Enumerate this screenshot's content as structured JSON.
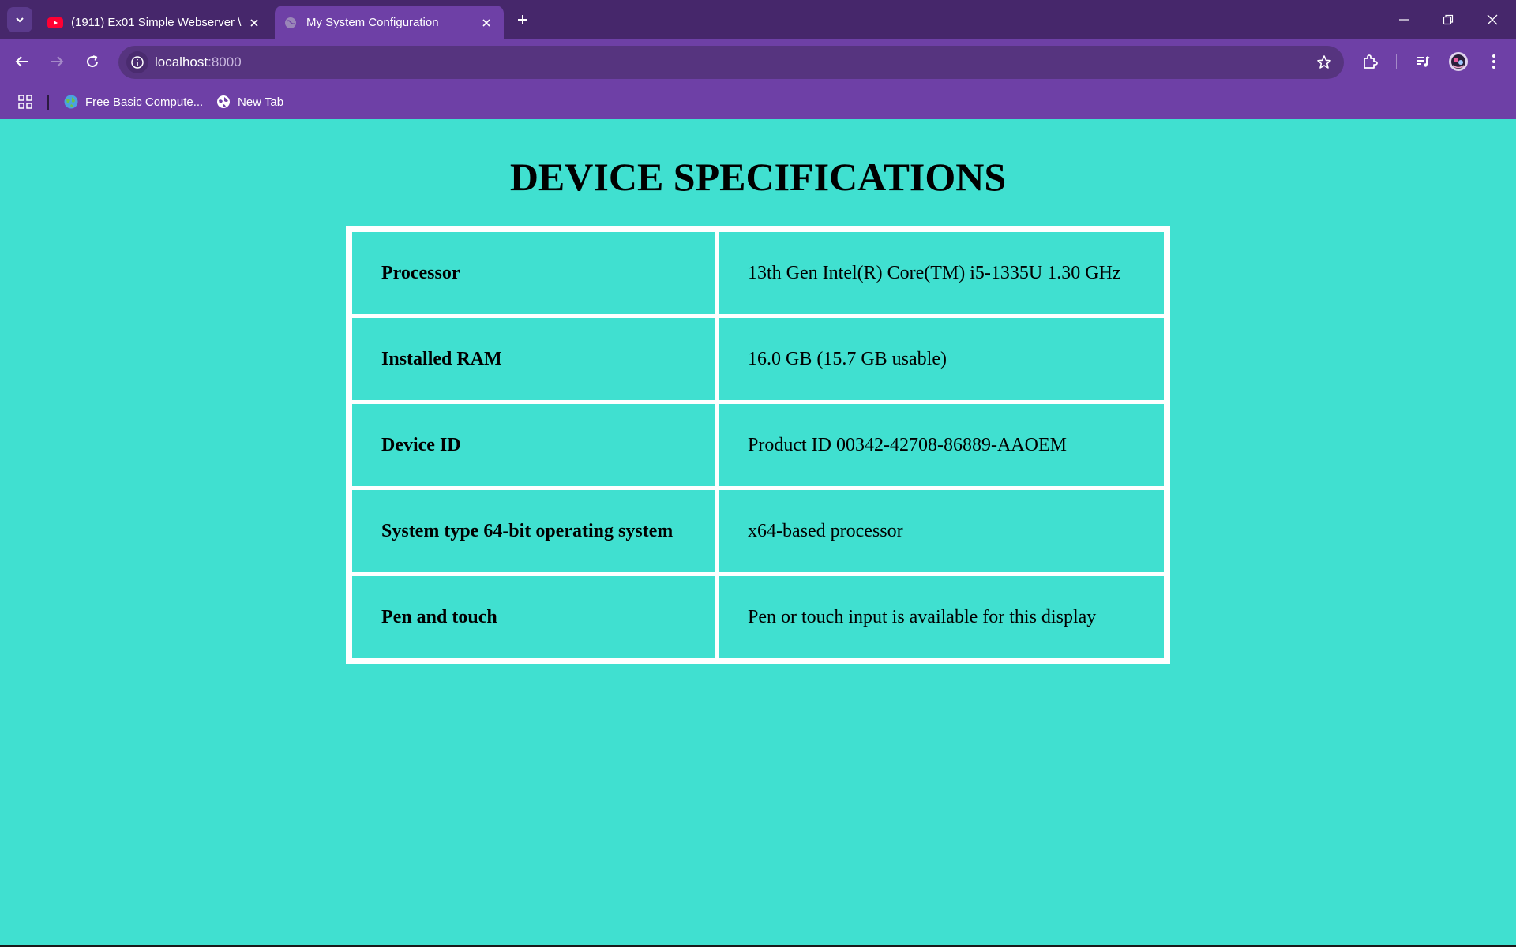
{
  "browser": {
    "tabs": [
      {
        "title": "(1911) Ex01 Simple Webserver \\",
        "favicon": "youtube-icon",
        "active": false
      },
      {
        "title": "My System Configuration",
        "favicon": "globe-icon",
        "active": true
      }
    ],
    "address": {
      "host": "localhost",
      "port": ":8000"
    },
    "bookmarks": [
      {
        "label": "Free Basic Compute...",
        "icon": "earth-icon"
      },
      {
        "label": "New Tab",
        "icon": "globe-icon"
      }
    ],
    "colors": {
      "frame": "#46276b",
      "toolbar": "#6e40a6",
      "omnibox": "#56347f"
    }
  },
  "page": {
    "heading": "DEVICE SPECIFICATIONS",
    "background": "#40e0d0",
    "rows": [
      {
        "key": "Processor",
        "value": "13th Gen Intel(R) Core(TM) i5-1335U 1.30 GHz"
      },
      {
        "key": "Installed RAM",
        "value": "16.0 GB (15.7 GB usable)"
      },
      {
        "key": "Device ID",
        "value": "Product ID 00342-42708-86889-AAOEM"
      },
      {
        "key": "System type 64-bit operating system",
        "value": "x64-based processor"
      },
      {
        "key": "Pen and touch",
        "value": "Pen or touch input is available for this display"
      }
    ]
  }
}
